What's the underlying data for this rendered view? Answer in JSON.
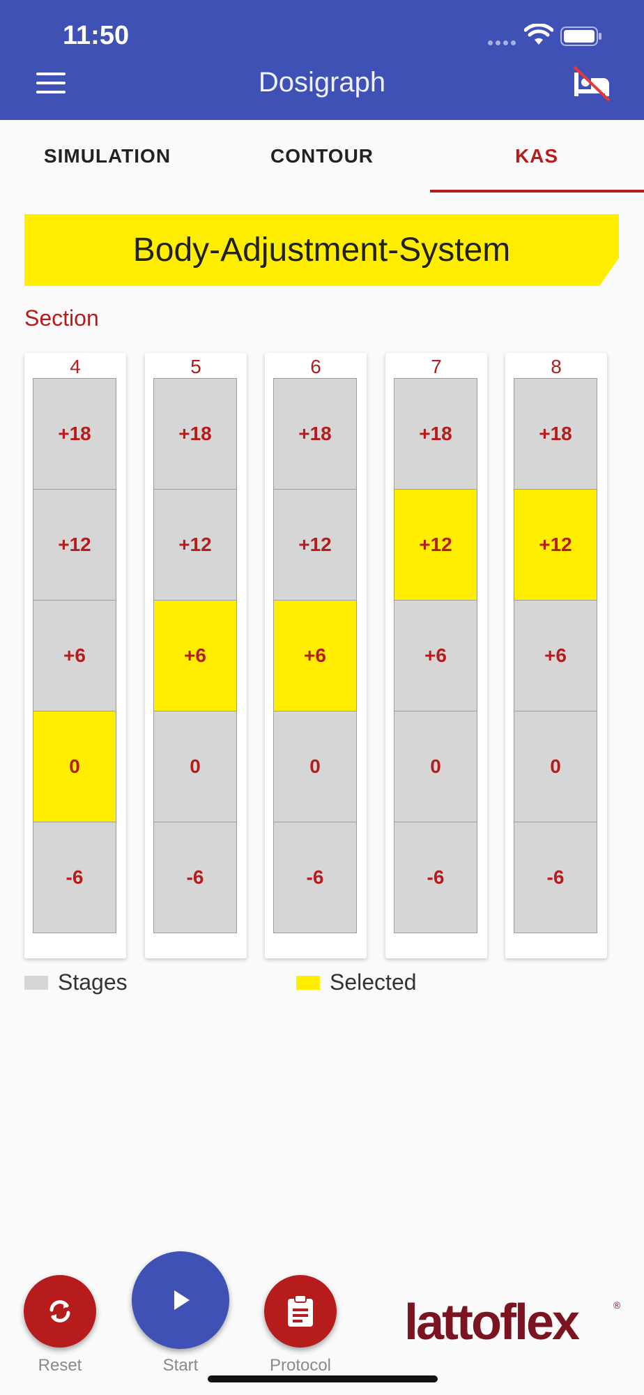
{
  "status_bar": {
    "time": "11:50"
  },
  "app_bar": {
    "title": "Dosigraph"
  },
  "tabs": [
    {
      "label": "SIMULATION",
      "active": false
    },
    {
      "label": "CONTOUR",
      "active": false
    },
    {
      "label": "KAS",
      "active": true
    }
  ],
  "banner": {
    "title": "Body-Adjustment-System"
  },
  "section_label": "Section",
  "stage_labels": [
    "+18",
    "+12",
    "+6",
    "0",
    "-6"
  ],
  "columns": [
    {
      "number": "4",
      "selected": "0"
    },
    {
      "number": "5",
      "selected": "+6"
    },
    {
      "number": "6",
      "selected": "+6"
    },
    {
      "number": "7",
      "selected": "+12"
    },
    {
      "number": "8",
      "selected": "+12"
    }
  ],
  "legend": {
    "stages": "Stages",
    "selected": "Selected"
  },
  "actions": {
    "reset": "Reset",
    "start": "Start",
    "protocol": "Protocol"
  },
  "brand": {
    "logo_text": "lattoflex",
    "registered": "®"
  },
  "colors": {
    "primary": "#3f51b5",
    "accent_red": "#b71c1c",
    "selected_yellow": "#ffee00",
    "stage_gray": "#d6d6d6"
  },
  "icons": {
    "menu": "menu-icon",
    "bed_off": "bed-off-icon",
    "reset": "refresh-icon",
    "start": "play-icon",
    "protocol": "clipboard-icon"
  }
}
